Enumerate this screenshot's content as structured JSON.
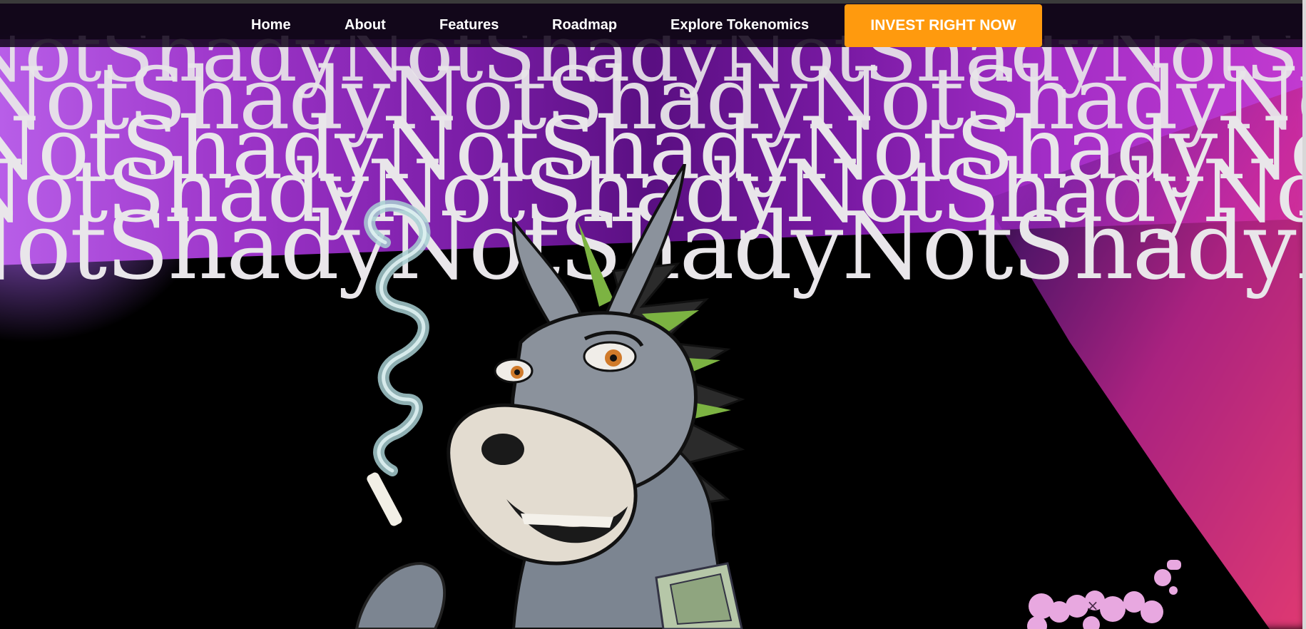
{
  "nav": {
    "home": "Home",
    "about": "About",
    "features": "Features",
    "roadmap": "Roadmap",
    "tokenomics": "Explore Tokenomics",
    "cta": "INVEST RIGHT NOW"
  },
  "hero": {
    "repeated_text": "NotShadyNotShadyNotShadyNotShadyNotShady"
  },
  "widget": {
    "close_glyph": "×"
  },
  "colors": {
    "cta_bg": "#ff9a0e",
    "nav_bg": "#14081e",
    "wordmark_text": "#e9e6ea",
    "purple": "#9d35c9",
    "pink": "#eb3c78",
    "blob": "#e8a8e0"
  },
  "icons": {
    "close": "close-icon"
  }
}
